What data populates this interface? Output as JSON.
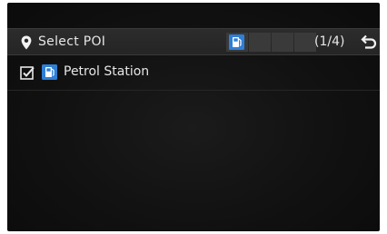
{
  "header": {
    "title": "Select POI",
    "page_indicator": "(1/4)",
    "poi_slots": [
      {
        "icon": "fuel-icon",
        "active": true
      },
      {
        "icon": "",
        "active": false
      },
      {
        "icon": "",
        "active": false
      },
      {
        "icon": "",
        "active": false
      }
    ]
  },
  "list": {
    "items": [
      {
        "label": "Petrol Station",
        "checked": true,
        "icon": "fuel-icon"
      }
    ]
  },
  "colors": {
    "accent": "#2f7fd6",
    "background": "#121212",
    "header": "#2a2a2a",
    "text": "#e6e6e6"
  }
}
